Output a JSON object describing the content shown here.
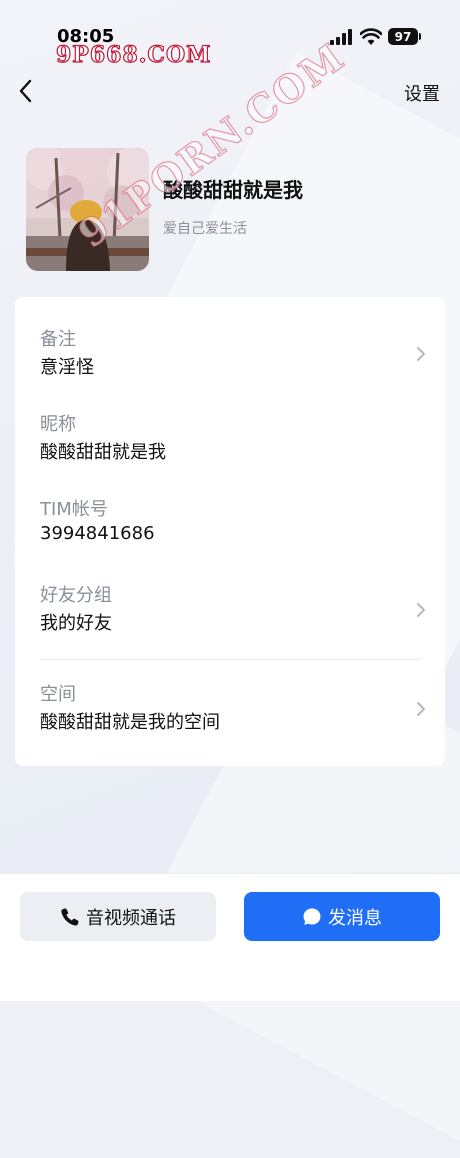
{
  "status_bar": {
    "time": "08:05",
    "watermark": "9P668.COM",
    "battery": "97"
  },
  "header": {
    "settings_label": "设置"
  },
  "profile": {
    "name": "酸酸甜甜就是我",
    "signature": "爱自己爱生活",
    "watermark": "91PORN.COM"
  },
  "info": {
    "remark": {
      "label": "备注",
      "value": "意淫怪"
    },
    "nickname": {
      "label": "昵称",
      "value": "酸酸甜甜就是我"
    },
    "tim_id": {
      "label": "TIM帐号",
      "value": "3994841686"
    },
    "group": {
      "label": "好友分组",
      "value": "我的好友"
    },
    "space": {
      "label": "空间",
      "value": "酸酸甜甜就是我的空间"
    }
  },
  "actions": {
    "call_label": "音视频通话",
    "message_label": "发消息"
  },
  "colors": {
    "accent": "#1f6ef5",
    "watermark_red": "#c01b3a"
  },
  "icons": {
    "back": "chevron-left-icon",
    "chevron": "chevron-right-icon",
    "phone": "phone-icon",
    "chat": "chat-bubble-icon"
  }
}
